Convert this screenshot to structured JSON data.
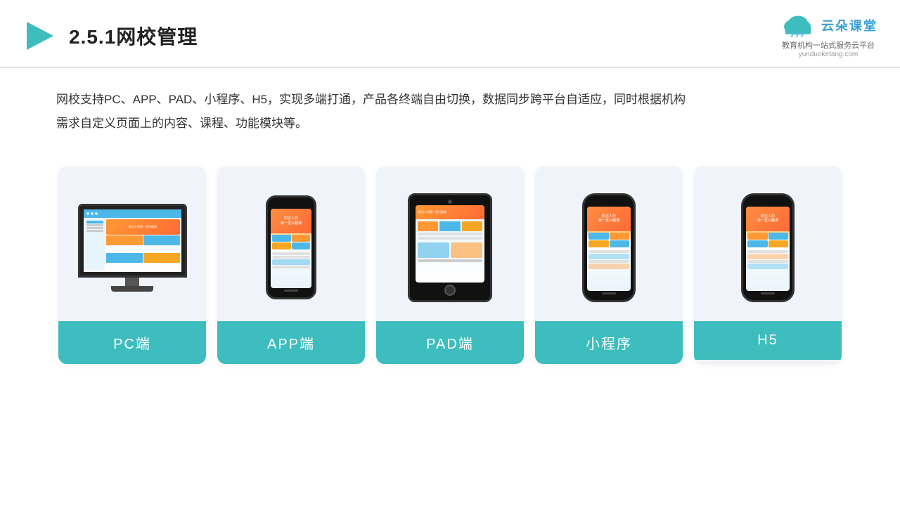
{
  "header": {
    "title": "2.5.1网校管理",
    "logo": {
      "name": "云朵课堂",
      "url": "yunduoketang.com",
      "tagline": "教育机构一站式服务云平台"
    }
  },
  "description": {
    "text": "网校支持PC、APP、PAD、小程序、H5，实现多端打通，产品各终端自由切换，数据同步跨平台自适应，同时根据机构需求自定义页面上的内容、课程、功能模块等。"
  },
  "cards": [
    {
      "id": "pc",
      "label": "PC端",
      "type": "pc"
    },
    {
      "id": "app",
      "label": "APP端",
      "type": "phone"
    },
    {
      "id": "pad",
      "label": "PAD端",
      "type": "tablet"
    },
    {
      "id": "miniapp",
      "label": "小程序",
      "type": "phone"
    },
    {
      "id": "h5",
      "label": "H5",
      "type": "phone"
    }
  ],
  "colors": {
    "teal": "#3dbdbd",
    "accent": "#4db8e8",
    "orange": "#ff9933",
    "dark": "#222"
  }
}
